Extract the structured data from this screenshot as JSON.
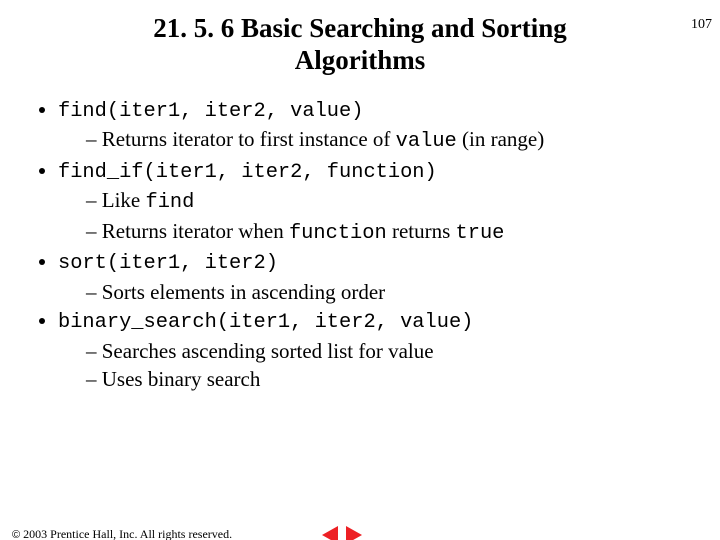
{
  "page_number": "107",
  "title": "21. 5. 6 Basic Searching and Sorting Algorithms",
  "items": [
    {
      "code": "find(iter1, iter2, value)",
      "subs": [
        {
          "pre": "Returns iterator to first instance of ",
          "code": "value",
          "post": " (in range)"
        }
      ]
    },
    {
      "code": "find_if(iter1, iter2, function)",
      "subs": [
        {
          "pre": "Like ",
          "code": "find",
          "post": ""
        },
        {
          "pre": "Returns iterator when ",
          "code": "function",
          "post": " returns ",
          "code2": "true"
        }
      ]
    },
    {
      "code": "sort(iter1, iter2)",
      "subs": [
        {
          "pre": "Sorts elements in ascending order",
          "code": "",
          "post": ""
        }
      ]
    },
    {
      "code": "binary_search(iter1, iter2, value)",
      "subs": [
        {
          "pre": "Searches ascending sorted list for value",
          "code": "",
          "post": ""
        },
        {
          "pre": "Uses binary search",
          "code": "",
          "post": ""
        }
      ]
    }
  ],
  "footer": "2003 Prentice Hall, Inc. All rights reserved."
}
